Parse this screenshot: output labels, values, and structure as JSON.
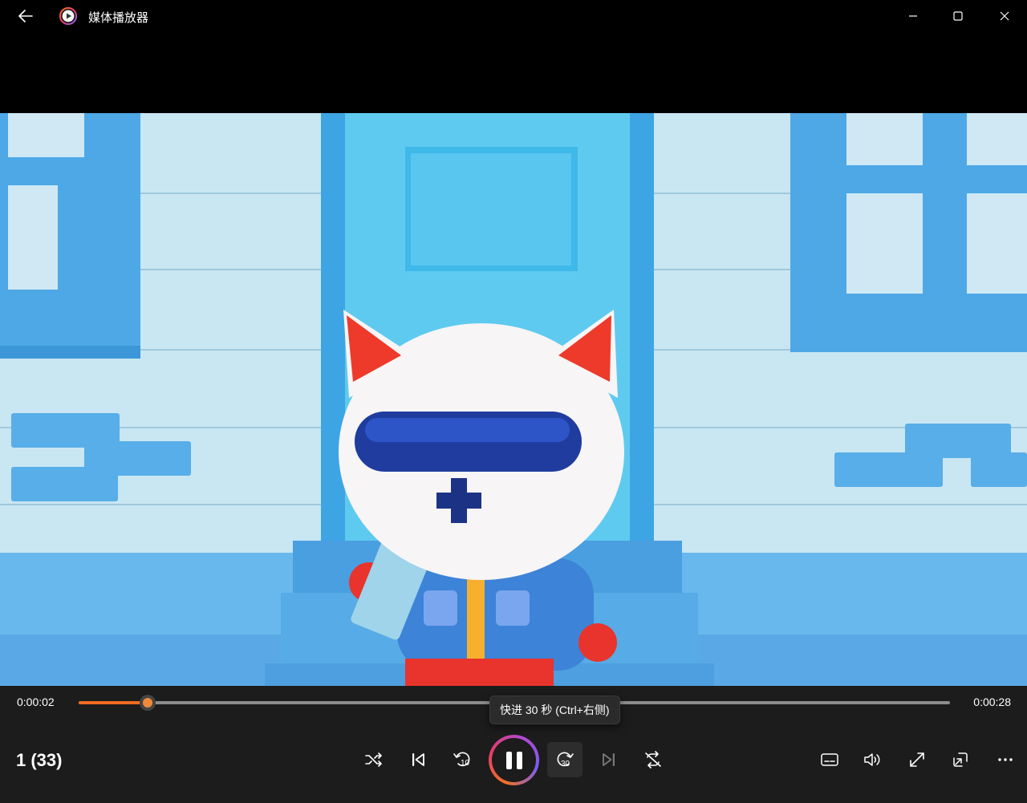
{
  "window": {
    "title": "媒体播放器"
  },
  "player": {
    "current_time": "0:00:02",
    "total_time": "0:00:28",
    "progress_fraction": 0.079,
    "playlist_position": "1 (33)",
    "tooltip": "快进 30 秒 (Ctrl+右侧)",
    "skip_back_label": "10",
    "skip_forward_label": "30"
  },
  "colors": {
    "accent": "#f06b22",
    "panel_bg": "#1c1c1c",
    "titlebar_bg": "#000000"
  },
  "icons": {
    "back": "back-arrow-icon",
    "app": "media-player-logo-icon",
    "minimize": "minimize-icon",
    "maximize": "maximize-icon",
    "close": "close-icon",
    "shuffle": "shuffle-icon",
    "previous": "previous-icon",
    "rewind": "rewind-10-icon",
    "pause": "pause-icon",
    "forward": "forward-30-icon",
    "next": "next-icon",
    "repeat": "repeat-icon",
    "subtitles": "subtitles-icon",
    "volume": "volume-icon",
    "fullscreen": "fullscreen-icon",
    "miniplayer": "miniplayer-icon",
    "more": "more-icon"
  }
}
